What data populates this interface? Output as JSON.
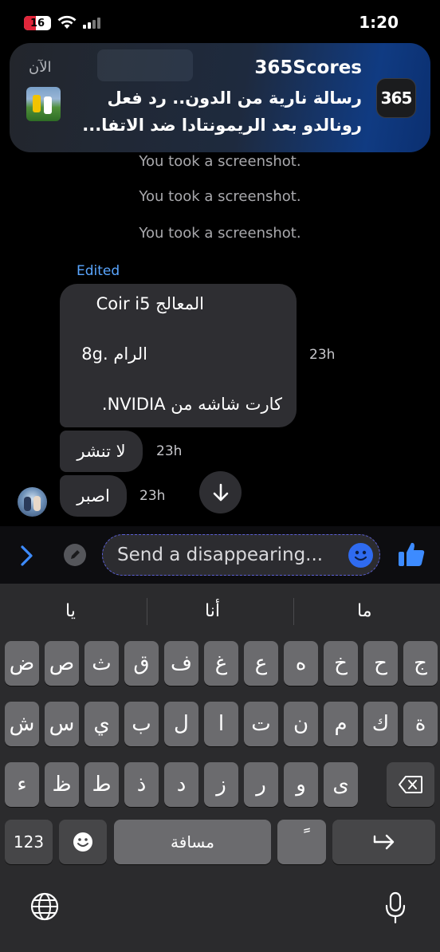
{
  "status_bar": {
    "battery": "16",
    "time": "1:20"
  },
  "notification": {
    "app": "365Scores",
    "time": "الآن",
    "icon_text": "365",
    "line1": "رسالة نارية من الدون.. رد فعل",
    "line2": "رونالدو بعد الريمونتادا ضد الاتفا..."
  },
  "chat": {
    "system_messages": [
      "You took a screenshot.",
      "You took a screenshot.",
      "You took a screenshot."
    ],
    "edited_label": "Edited",
    "message_1": {
      "lines": [
        "المعالج Coir i5",
        "الرام .8g",
        "كارت شاشه من NVIDIA."
      ],
      "time": "23h"
    },
    "message_2": {
      "text": "لا تنشر",
      "time": "23h"
    },
    "message_3": {
      "text": "اصبر",
      "time": "23h"
    }
  },
  "composer": {
    "placeholder": "Send a disappearing..."
  },
  "keyboard": {
    "suggestions": [
      "يا",
      "أنا",
      "ما"
    ],
    "row1": [
      "ض",
      "ص",
      "ث",
      "ق",
      "ف",
      "غ",
      "ع",
      "ه",
      "خ",
      "ح",
      "ج"
    ],
    "row2": [
      "ش",
      "س",
      "ي",
      "ب",
      "ل",
      "ا",
      "ت",
      "ن",
      "م",
      "ك",
      "ة"
    ],
    "row3": [
      "ء",
      "ظ",
      "ط",
      "ذ",
      "د",
      "ز",
      "ر",
      "و",
      "ى"
    ],
    "numbers_key": "123",
    "space_key": "مسافة",
    "diacritic_key": "ً"
  },
  "colors": {
    "accent": "#2f6bf0",
    "edited": "#5aa6ff",
    "bubble": "#2e2e32"
  }
}
